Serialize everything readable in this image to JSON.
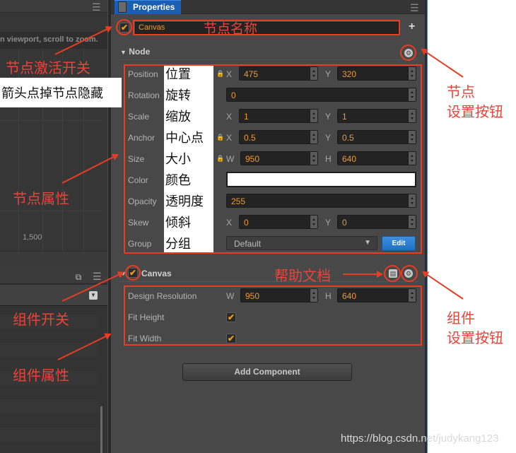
{
  "scene_panel": {
    "hint_text": "n viewport, scroll to zoom.",
    "ruler_label": "1,500",
    "icons": [
      "menu-icon"
    ]
  },
  "hierarchy_panel": {
    "icons": [
      "popout-icon",
      "menu-icon",
      "dropdown-icon"
    ]
  },
  "properties": {
    "tab_label": "Properties",
    "node_active": true,
    "node_name": "Canvas",
    "node_section": {
      "title": "Node",
      "rows": [
        {
          "label": "Position",
          "cn": "位置",
          "locked": true,
          "a_axis": "X",
          "a_value": "475",
          "b_axis": "Y",
          "b_value": "320"
        },
        {
          "label": "Rotation",
          "cn": "旋转",
          "value": "0"
        },
        {
          "label": "Scale",
          "cn": "缩放",
          "a_axis": "X",
          "a_value": "1",
          "b_axis": "Y",
          "b_value": "1"
        },
        {
          "label": "Anchor",
          "cn": "中心点",
          "locked": true,
          "a_axis": "X",
          "a_value": "0.5",
          "b_axis": "Y",
          "b_value": "0.5"
        },
        {
          "label": "Size",
          "cn": "大小",
          "locked": true,
          "a_axis": "W",
          "a_value": "950",
          "b_axis": "H",
          "b_value": "640"
        },
        {
          "label": "Color",
          "cn": "颜色",
          "color": "#ffffff"
        },
        {
          "label": "Opacity",
          "cn": "透明度",
          "value": "255"
        },
        {
          "label": "Skew",
          "cn": "倾斜",
          "a_axis": "X",
          "a_value": "0",
          "b_axis": "Y",
          "b_value": "0"
        },
        {
          "label": "Group",
          "cn": "分组",
          "select_value": "Default",
          "edit_label": "Edit"
        }
      ]
    },
    "canvas_component": {
      "title": "Canvas",
      "enabled": true,
      "design_resolution": {
        "label": "Design Resolution",
        "w_axis": "W",
        "w_value": "950",
        "h_axis": "H",
        "h_value": "640"
      },
      "fit_height": {
        "label": "Fit Height",
        "checked": true
      },
      "fit_width": {
        "label": "Fit Width",
        "checked": true
      }
    },
    "add_component_label": "Add Component"
  },
  "annotations": {
    "node_name": "节点名称",
    "node_active_switch": "节点激活开关",
    "arrow_hint": "箭头点掉节点隐藏",
    "node_props": "节点属性",
    "node_settings_line1": "节点",
    "node_settings_line2": "设置按钮",
    "help_doc": "帮助文档",
    "component_switch": "组件开关",
    "component_props": "组件属性",
    "component_settings_line1": "组件",
    "component_settings_line2": "设置按钮"
  },
  "watermark": "https://blog.csdn.net/judykang123",
  "colors": {
    "accent_orange": "#f09a2a",
    "tab_blue": "#1a5fb4",
    "annotation_red": "#e83d23"
  }
}
